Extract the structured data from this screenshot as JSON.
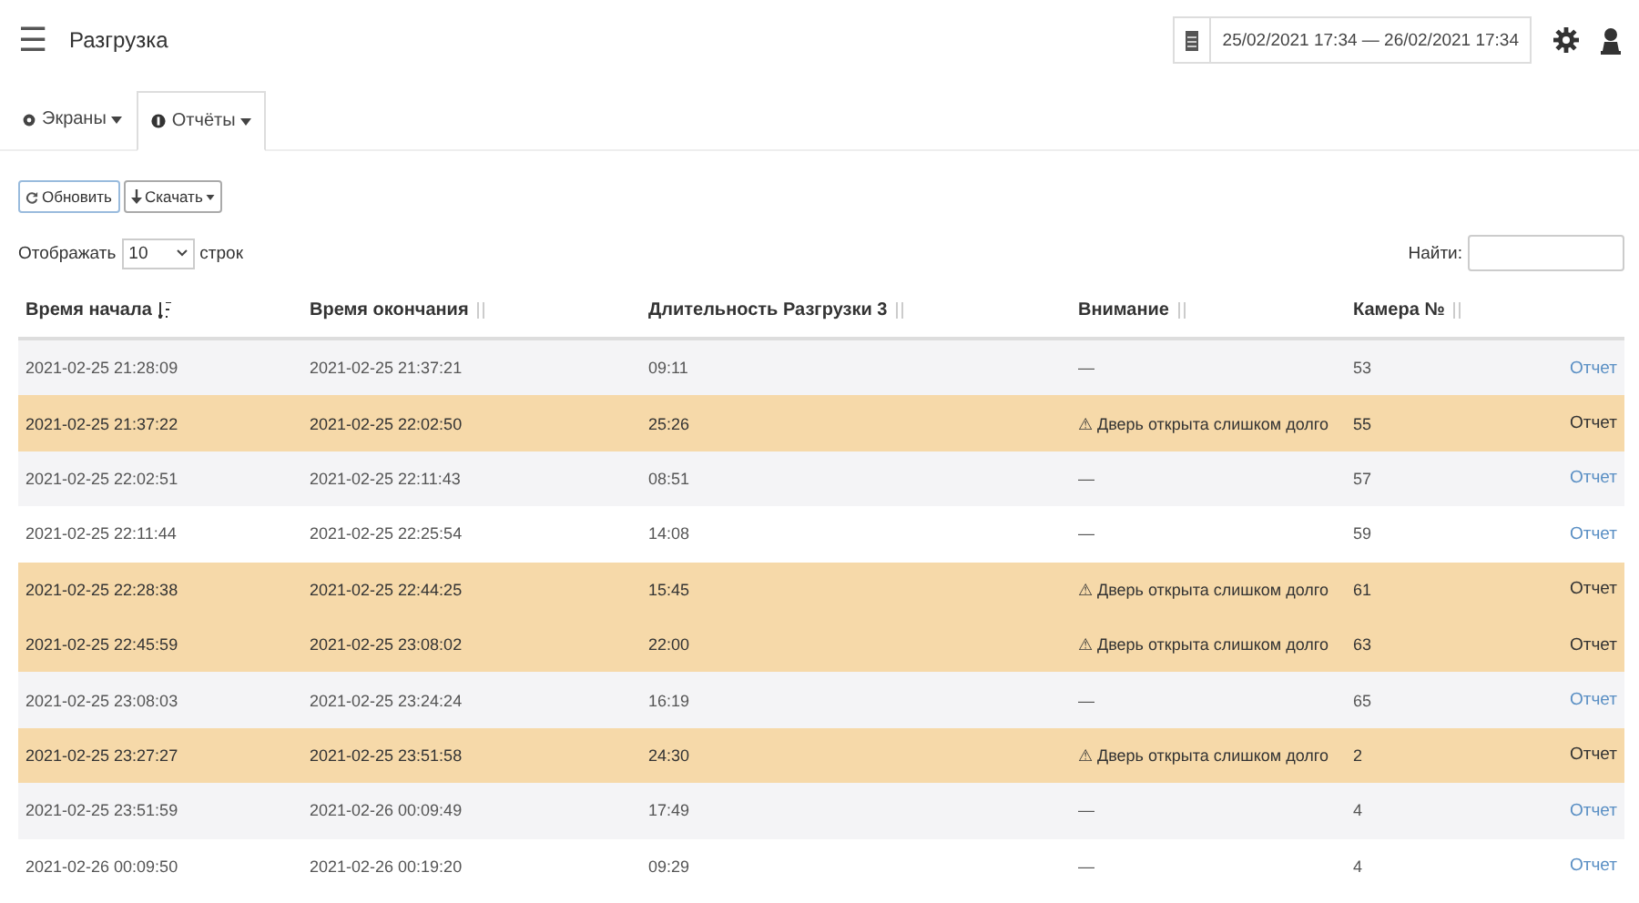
{
  "header": {
    "menu_glyph": "☰",
    "title": "Разгрузка",
    "date_range": "25/02/2021 17:34 — 26/02/2021 17:34"
  },
  "tabs": [
    {
      "label": "Экраны",
      "selected": false
    },
    {
      "label": "Отчёты",
      "selected": true
    }
  ],
  "toolbar": {
    "refresh": "Обновить",
    "download": "Скачать"
  },
  "length": {
    "label_before": "Отображать",
    "value": "10",
    "label_after": "строк"
  },
  "search": {
    "label": "Найти:"
  },
  "table": {
    "columns": [
      "Время начала",
      "Время окончания",
      "Длительность Разгрузки 3",
      "Внимание",
      "Камера №"
    ],
    "rows": [
      {
        "kind": "normal",
        "cells": [
          "2021-02-25 21:28:09",
          "2021-02-25 21:37:21",
          "09:11",
          "—",
          "53"
        ],
        "link": "Отчет"
      },
      {
        "kind": "warning",
        "cells": [
          "2021-02-25 21:37:22",
          "2021-02-25 22:02:50",
          "25:26",
          "⚠ Дверь открыта слишком долго",
          "55"
        ],
        "link": "Отчет"
      },
      {
        "kind": "normal",
        "cells": [
          "2021-02-25 22:02:51",
          "2021-02-25 22:11:43",
          "08:51",
          "—",
          "57"
        ],
        "link": "Отчет"
      },
      {
        "kind": "normal",
        "cells": [
          "2021-02-25 22:11:44",
          "2021-02-25 22:25:54",
          "14:08",
          "—",
          "59"
        ],
        "link": "Отчет"
      },
      {
        "kind": "warning",
        "cells": [
          "2021-02-25 22:28:38",
          "2021-02-25 22:44:25",
          "15:45",
          "⚠ Дверь открыта слишком долго",
          "61"
        ],
        "link": "Отчет"
      },
      {
        "kind": "warning",
        "cells": [
          "2021-02-25 22:45:59",
          "2021-02-25 23:08:02",
          "22:00",
          "⚠ Дверь открыта слишком долго",
          "63"
        ],
        "link": "Отчет"
      },
      {
        "kind": "normal",
        "cells": [
          "2021-02-25 23:08:03",
          "2021-02-25 23:24:24",
          "16:19",
          "—",
          "65"
        ],
        "link": "Отчет"
      },
      {
        "kind": "warning",
        "cells": [
          "2021-02-25 23:27:27",
          "2021-02-25 23:51:58",
          "24:30",
          "⚠ Дверь открыта слишком долго",
          "2"
        ],
        "link": "Отчет"
      },
      {
        "kind": "normal",
        "cells": [
          "2021-02-25 23:51:59",
          "2021-02-26 00:09:49",
          "17:49",
          "—",
          "4"
        ],
        "link": "Отчет"
      },
      {
        "kind": "normal",
        "cells": [
          "2021-02-26 00:09:50",
          "2021-02-26 00:19:20",
          "09:29",
          "—",
          "4"
        ],
        "link": "Отчет"
      }
    ]
  }
}
